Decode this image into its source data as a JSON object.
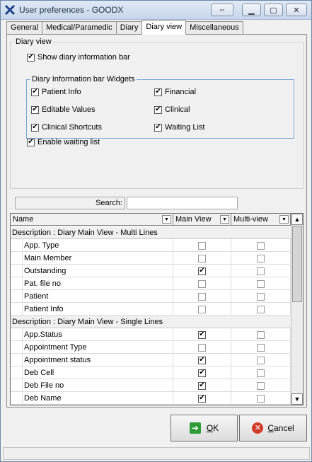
{
  "window": {
    "title": "User preferences - GOODX"
  },
  "tabs": [
    "General",
    "Medical/Paramedic",
    "Diary",
    "Diary view",
    "Miscellaneous"
  ],
  "diary_view": {
    "group_title": "Diary view",
    "show_info_bar_label": "Show diary information bar",
    "widgets_group_title": "Diary Information bar Widgets",
    "widgets": [
      "Patient Info",
      "Financial",
      "Editable Values",
      "Clinical",
      "Clinical Shortcuts",
      "Waiting List"
    ],
    "enable_waiting_list_label": "Enable waiting list"
  },
  "search": {
    "label": "Search:",
    "value": ""
  },
  "grid": {
    "columns": [
      "Name",
      "Main View",
      "Multi-view"
    ],
    "sections": [
      {
        "title": "Description : Diary Main View - Multi Lines",
        "rows": [
          {
            "name": "App. Type",
            "main": false,
            "multi": false
          },
          {
            "name": "Main Member",
            "main": false,
            "multi": false
          },
          {
            "name": "Outstanding",
            "main": true,
            "multi": false
          },
          {
            "name": "Pat. file no",
            "main": false,
            "multi": false
          },
          {
            "name": "Patient",
            "main": false,
            "multi": false
          },
          {
            "name": "Patient Info",
            "main": false,
            "multi": false
          }
        ]
      },
      {
        "title": "Description : Diary Main View - Single Lines",
        "rows": [
          {
            "name": "App.Status",
            "main": true,
            "multi": false
          },
          {
            "name": "Appointment Type",
            "main": false,
            "multi": false
          },
          {
            "name": "Appointment status",
            "main": true,
            "multi": false
          },
          {
            "name": "Deb Cell",
            "main": true,
            "multi": false
          },
          {
            "name": "Deb File no",
            "main": true,
            "multi": false
          },
          {
            "name": "Deb Name",
            "main": true,
            "multi": false
          }
        ]
      }
    ]
  },
  "buttons": {
    "ok_prefix": "",
    "ok_underlined": "O",
    "ok_rest": "K",
    "cancel_underlined": "C",
    "cancel_rest": "ancel"
  }
}
